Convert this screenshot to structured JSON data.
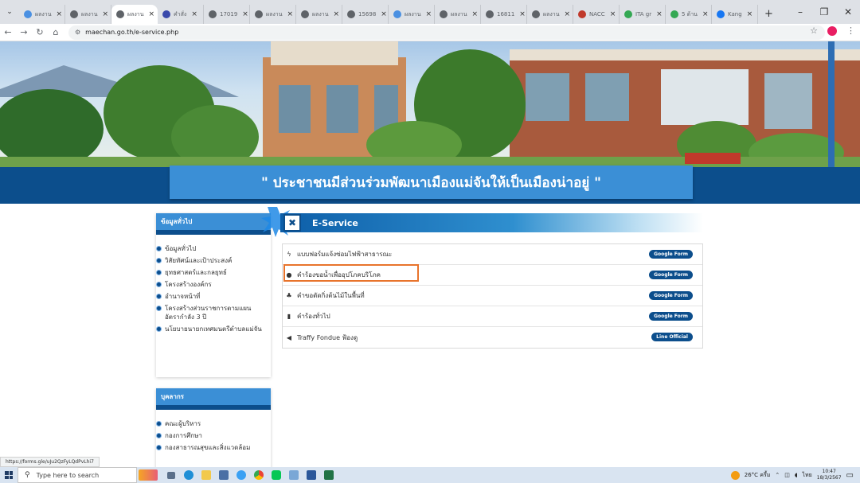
{
  "browser": {
    "tabs": [
      {
        "label": "ผลงาน",
        "color": "#4a90e2"
      },
      {
        "label": "ผลงาน",
        "color": "#5f6368"
      },
      {
        "label": "ผลงาน",
        "color": "#5f6368",
        "active": true
      },
      {
        "label": "คำสั่ง",
        "color": "#3949ab"
      },
      {
        "label": "17019",
        "color": "#5f6368"
      },
      {
        "label": "ผลงาน",
        "color": "#5f6368"
      },
      {
        "label": "ผลงาน",
        "color": "#5f6368"
      },
      {
        "label": "15698",
        "color": "#5f6368"
      },
      {
        "label": "ผลงาน",
        "color": "#4a90e2"
      },
      {
        "label": "ผลงาน",
        "color": "#5f6368"
      },
      {
        "label": "16811",
        "color": "#5f6368"
      },
      {
        "label": "ผลงาน",
        "color": "#5f6368"
      },
      {
        "label": "NACC",
        "color": "#c0392b"
      },
      {
        "label": "ITA gr",
        "color": "#34a853"
      },
      {
        "label": "5 ด้าน",
        "color": "#34a853"
      },
      {
        "label": "Kang",
        "color": "#1877f2"
      }
    ],
    "url": "maechan.go.th/e-service.php",
    "status_url": "https://forms.gle/uJu2QzFyLQdPvLhi7"
  },
  "page": {
    "slogan": "\" ประชาชนมีส่วนร่วมพัฒนาเมืองแม่จันให้เป็นเมืองน่าอยู่ \"",
    "sidebar_general": {
      "title": "ข้อมูลทั่วไป",
      "items": [
        "ข้อมูลทั่วไป",
        "วิสัยทัศน์และเป้าประสงค์",
        "ยุทธศาสตร์และกลยุทธ์",
        "โครงสร้างองค์กร",
        "อำนาจหน้าที่",
        "โครงสร้างส่วนราชการตามแผนอัตรากำลัง 3 ปี",
        "นโยบายนายกเทศมนตรีตำบลแม่จัน"
      ]
    },
    "sidebar_personnel": {
      "title": "บุคลากร",
      "items": [
        "คณะผู้บริหาร",
        "กองการศึกษา",
        "กองสาธารณสุขและสิ่งแวดล้อม"
      ]
    },
    "eservice": {
      "title": "E-Service",
      "items": [
        {
          "icon": "bolt-icon",
          "label": "แบบฟอร์มแจ้งซ่อมไฟฟ้าสาธารณะ",
          "badge": "Google Form"
        },
        {
          "icon": "water-drop-icon",
          "label": "คำร้องขอน้ำเพื่ออุปโภคบริโภค",
          "badge": "Google Form"
        },
        {
          "icon": "tree-icon",
          "label": "คำขอตัดกิ่งต้นไม้ในพื้นที่",
          "badge": "Google Form"
        },
        {
          "icon": "file-icon",
          "label": "คำร้องทั่วไป",
          "badge": "Google Form"
        },
        {
          "icon": "megaphone-icon",
          "label": "Traffy Fondue ฟ้องดู",
          "badge": "Line Official"
        }
      ]
    }
  },
  "taskbar": {
    "search_placeholder": "Type here to search",
    "weather": "26°C ครึ้ม",
    "lang": "ไทย",
    "time": "10:47",
    "date": "18/3/2567"
  }
}
